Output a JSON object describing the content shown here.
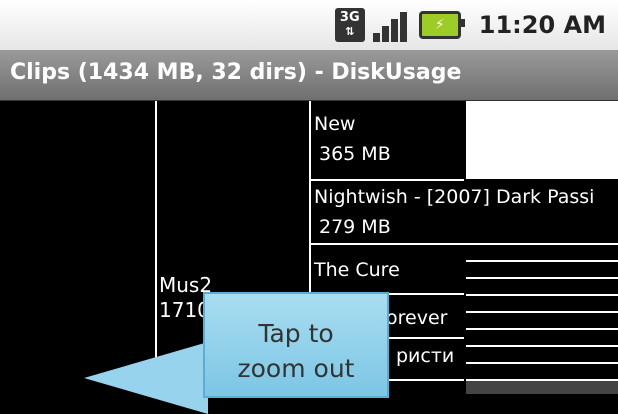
{
  "statusbar": {
    "network": "3G",
    "time": "11:20 AM"
  },
  "titlebar": {
    "title": "Clips (1434 MB, 32 dirs) - DiskUsage"
  },
  "treemap": {
    "mid_dir": {
      "name": "Mus2",
      "size": "1710"
    },
    "entries": [
      {
        "name": "New",
        "size": "365 MB"
      },
      {
        "name": "Nightwish - [2007] Dark Passi",
        "size": "279 MB"
      },
      {
        "name": "The Cure",
        "size": ""
      },
      {
        "name": "orever",
        "size": ""
      },
      {
        "name": "ристи",
        "size": ""
      }
    ]
  },
  "hint": {
    "text_line1": "Tap to",
    "text_line2": "zoom out"
  },
  "colors": {
    "callout": "#8fcfe9",
    "titlebar": "#7f7f7f"
  }
}
